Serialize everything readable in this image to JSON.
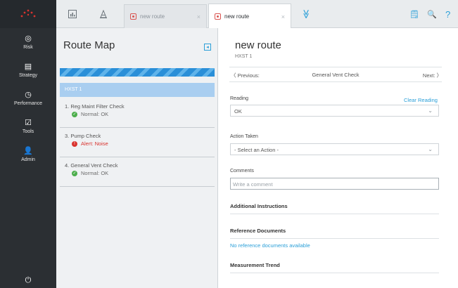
{
  "nav": {
    "items": [
      {
        "label": "Risk",
        "icon": "risk-icon",
        "glyph": "◎"
      },
      {
        "label": "Strategy",
        "icon": "strategy-icon",
        "glyph": "▤"
      },
      {
        "label": "Performance",
        "icon": "performance-icon",
        "glyph": "◷"
      },
      {
        "label": "Tools",
        "icon": "tools-icon",
        "glyph": "☑"
      },
      {
        "label": "Admin",
        "icon": "admin-icon",
        "glyph": "👤"
      }
    ],
    "power_glyph": "⏻"
  },
  "topbar": {
    "tabs": [
      {
        "label": "new route",
        "close": "×"
      },
      {
        "label": "new route",
        "close": "×"
      }
    ],
    "overflow_glyph": "≫",
    "notes_glyph": "🗒",
    "search_glyph": "🔍",
    "help_glyph": "?"
  },
  "route_map": {
    "title": "Route Map",
    "collapse_glyph": "◂",
    "asset": "HXST 1",
    "checks": [
      {
        "title": "1. Reg Maint Filter Check",
        "status": "Normal: OK",
        "kind": "ok",
        "glyph": "✓"
      },
      {
        "title": "3. Pump Check",
        "status": "Alert: Noise",
        "kind": "alert",
        "glyph": "!"
      },
      {
        "title": "4. General Vent Check",
        "status": "Normal: OK",
        "kind": "ok",
        "glyph": "✓"
      }
    ]
  },
  "detail": {
    "title": "new route",
    "subtitle": "HXST 1",
    "previous_label": "〈 Previous:",
    "current_check": "General Vent Check",
    "next_label": "Next: 〉",
    "reading_label": "Reading",
    "clear_reading": "Clear Reading",
    "reading_value": "OK",
    "action_label": "Action Taken",
    "action_value": "- Select an Action -",
    "comments_label": "Comments",
    "comments_placeholder": "Write a comment",
    "additional_instructions": "Additional Instructions",
    "reference_documents": "Reference Documents",
    "no_reference": "No reference documents available",
    "measurement_trend": "Measurement Trend",
    "chevron_glyph": "⌄"
  },
  "colors": {
    "accent": "#2a9fd8",
    "ok": "#4cae4c",
    "alert": "#d9332e",
    "nav_bg": "#2b2f33"
  }
}
